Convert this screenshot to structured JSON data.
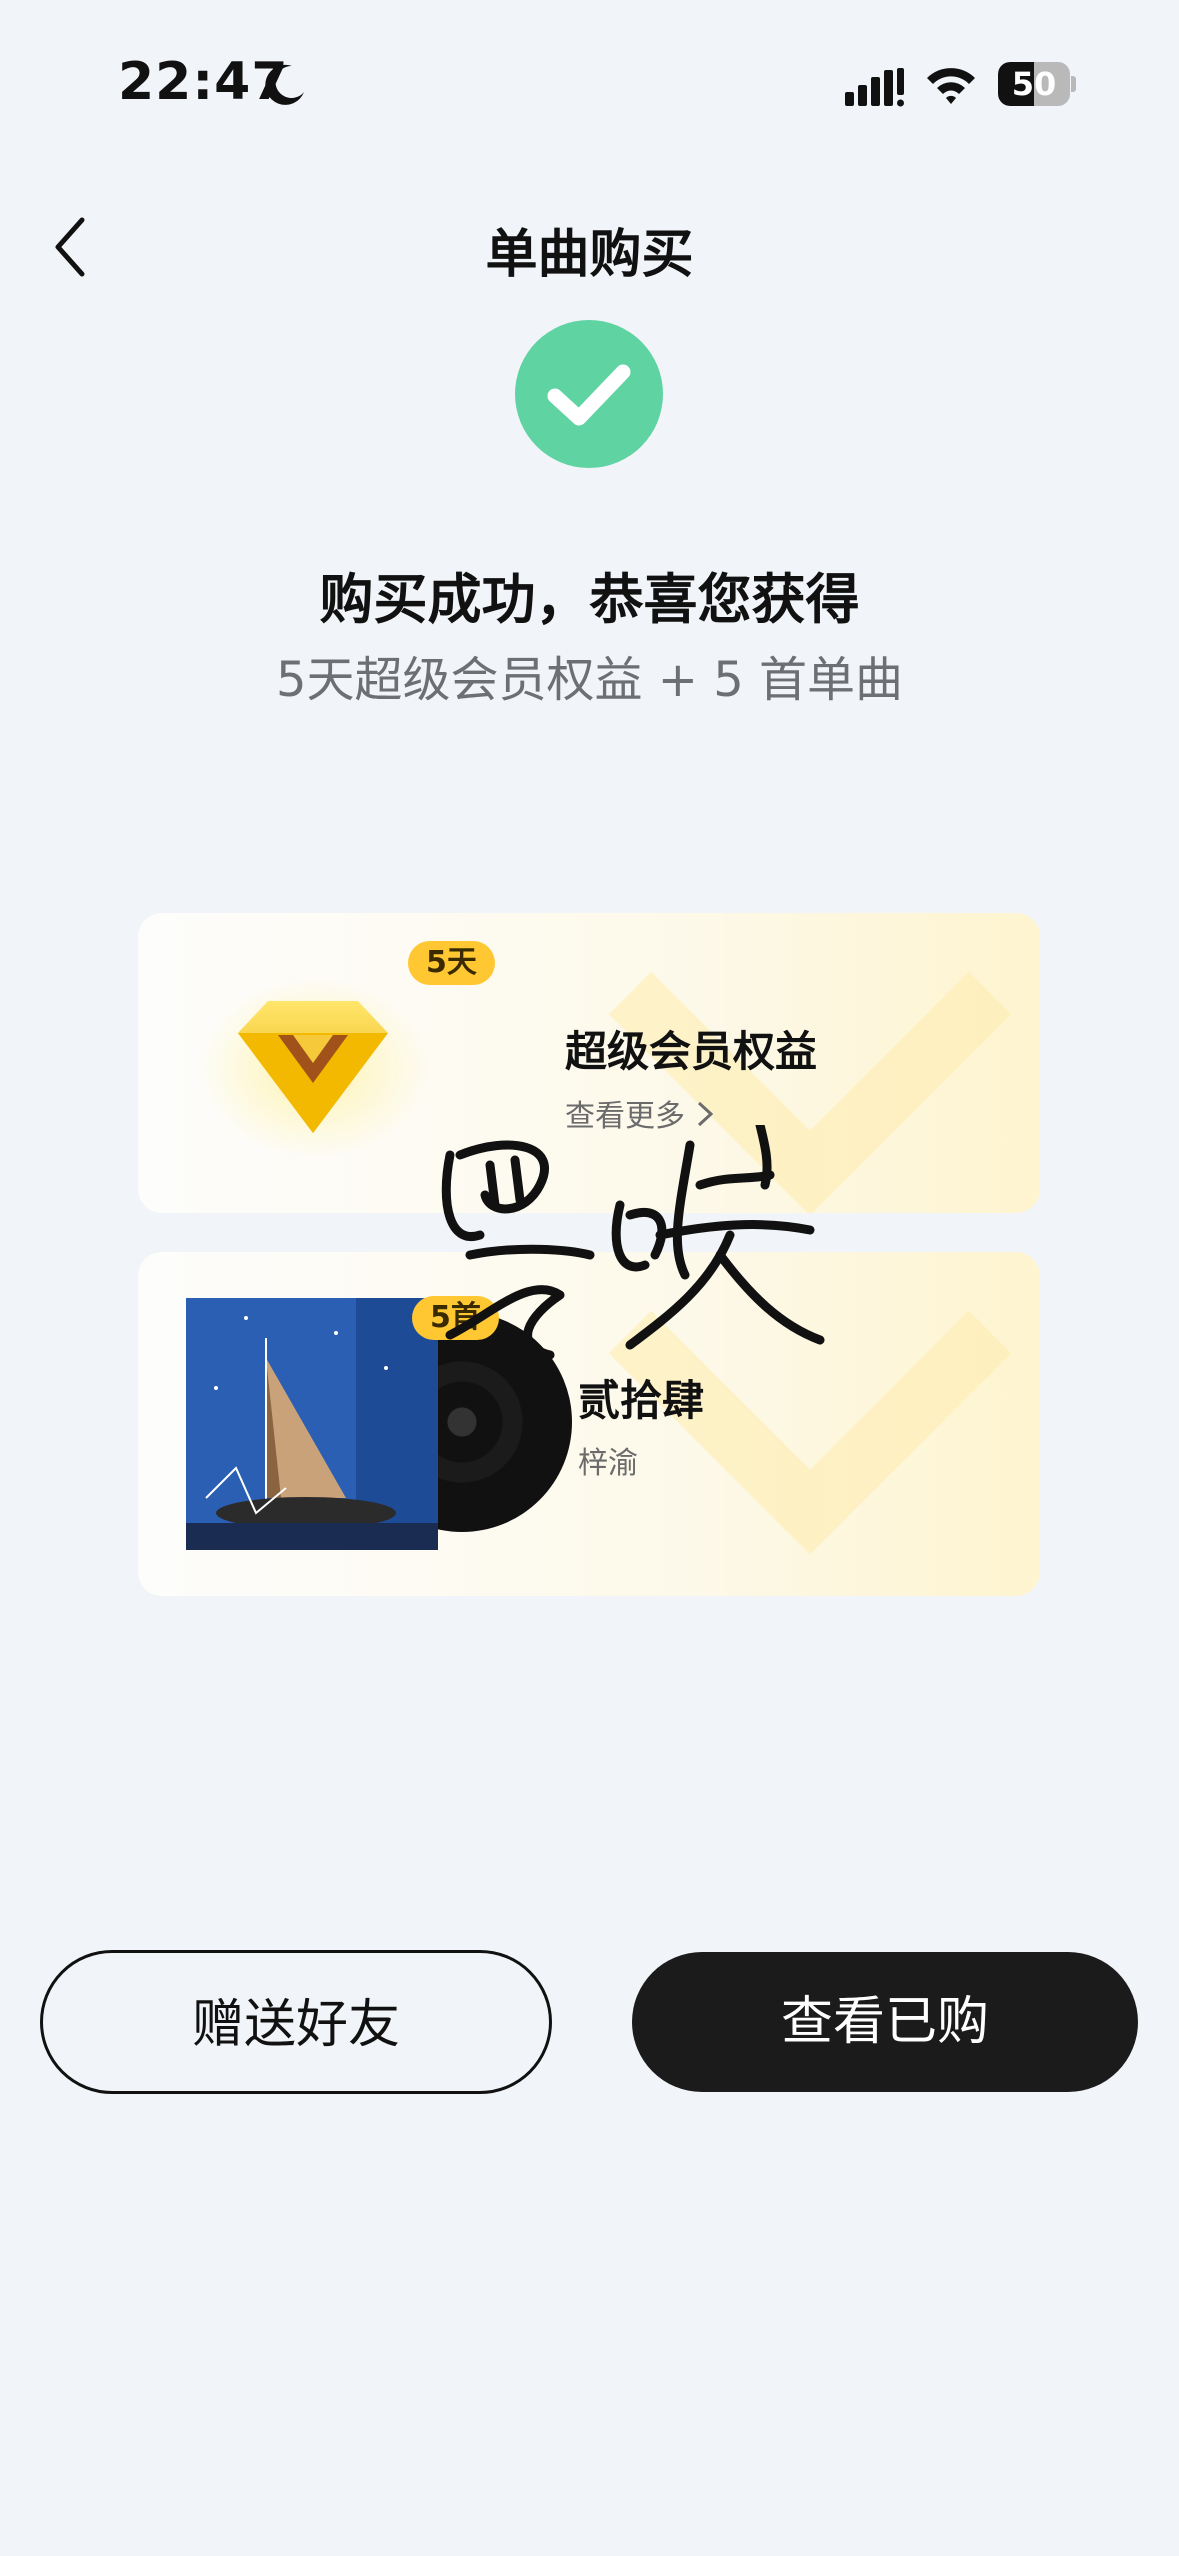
{
  "status_bar": {
    "time": "22:47",
    "battery": "50",
    "battery_level": 0.5
  },
  "nav": {
    "title": "单曲购买",
    "back_icon": "chevron-left-icon"
  },
  "success": {
    "icon": "check-circle-icon",
    "title": "购买成功，恭喜您获得",
    "subtitle": "5天超级会员权益 + 5 首单曲"
  },
  "cards": [
    {
      "badge": "5天",
      "title": "超级会员权益",
      "link": "查看更多",
      "icon": "diamond-icon"
    },
    {
      "badge": "5首",
      "title": "贰拾肆",
      "artist": "梓渝",
      "icon": "album-cover"
    }
  ],
  "buttons": {
    "gift": "赠送好友",
    "view": "查看已购"
  },
  "colors": {
    "accent_green": "#5fd3a1",
    "badge_yellow": "#ffc832",
    "primary_button": "#1b1b1b",
    "background": "#f1f4f8"
  }
}
